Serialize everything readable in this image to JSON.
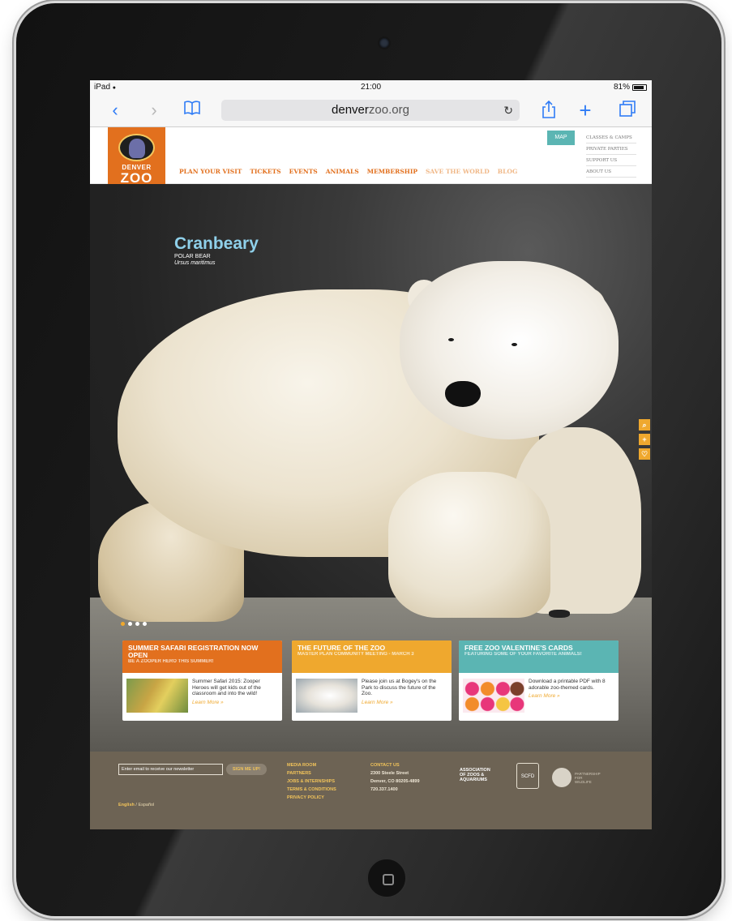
{
  "status_bar": {
    "device": "iPad",
    "wifi": "●",
    "time": "21:00",
    "battery": "81%"
  },
  "browser": {
    "url_domain": "denver",
    "url_rest": "zoo.org",
    "back_icon": "‹",
    "forward_icon": "›",
    "bookmarks_icon": "⚲",
    "reload_icon": "↻",
    "share_icon": "⇧",
    "add_icon": "+",
    "tabs_icon": "❐"
  },
  "site": {
    "logo_line1": "DENVER",
    "logo_line2": "ZOO",
    "nav": [
      "PLAN YOUR VISIT",
      "TICKETS",
      "EVENTS",
      "ANIMALS",
      "MEMBERSHIP",
      "SAVE THE WORLD",
      "BLOG"
    ],
    "map_label": "MAP",
    "util_nav": [
      "CLASSES & CAMPS",
      "PRIVATE PARTIES",
      "SUPPORT US",
      "ABOUT US"
    ]
  },
  "hero": {
    "animal_name": "Cranbeary",
    "species": "POLAR BEAR",
    "scientific": "Ursus maritimus",
    "side_buttons": [
      "⌕",
      "+",
      "♡"
    ]
  },
  "cards": [
    {
      "title": "SUMMER SAFARI REGISTRATION NOW OPEN",
      "subtitle": "BE A ZOOPER HERO THIS SUMMER!",
      "text": "Summer Safari 2015: Zooper Heroes will get kids out of the classroom and into the wild!",
      "link": "Learn More »",
      "color": "#e2701e"
    },
    {
      "title": "THE FUTURE OF THE ZOO",
      "subtitle": "MASTER PLAN COMMUNITY MEETING - MARCH 3",
      "text": "Please join us at Bogey's on the Park to discuss the future of the Zoo.",
      "link": "Learn More »",
      "color": "#efa82e"
    },
    {
      "title": "FREE ZOO VALENTINE'S CARDS",
      "subtitle": "FEATURING SOME OF YOUR FAVORITE ANIMALS!",
      "text": "Download a printable PDF with 8 adorable zoo-themed cards.",
      "link": "Learn More »",
      "color": "#5bb5b3"
    }
  ],
  "footer": {
    "newsletter_placeholder": "Enter email to receive our newsletter",
    "signup_label": "SIGN ME UP!",
    "lang_current": "English",
    "lang_other": " / Español",
    "links": [
      "MEDIA ROOM",
      "PARTNERS",
      "JOBS & INTERNSHIPS",
      "TERMS & CONDITIONS",
      "PRIVACY POLICY"
    ],
    "contact": [
      "CONTACT US",
      "2300 Steele Street",
      "Denver, CO 80205-4899",
      "720.337.1400"
    ],
    "partner1": [
      "ASSOCIATION",
      "OF ZOOS &",
      "AQUARIUMS"
    ],
    "partner2": "SCFD",
    "partner3": [
      "PARTNERSHIP",
      "FOR",
      "WILDLIFE"
    ]
  }
}
